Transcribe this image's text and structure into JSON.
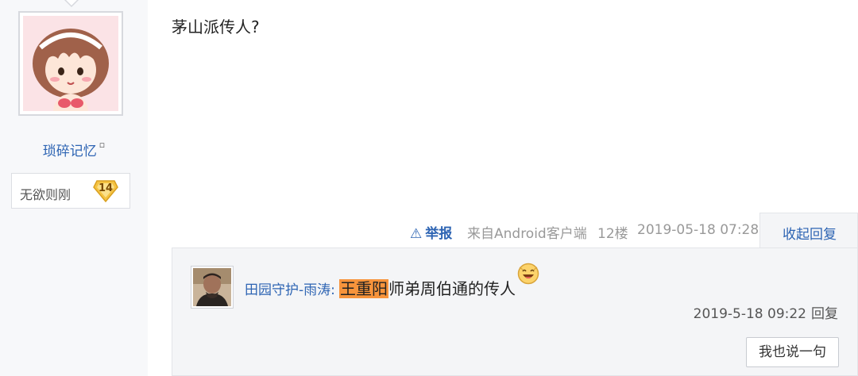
{
  "author": {
    "name": "琐碎记忆",
    "name_suffix": "▫",
    "level_name": "无欲则刚",
    "level_number": "14"
  },
  "post": {
    "content": "茅山派传人?"
  },
  "tail": {
    "report_icon": "⚠",
    "report_label": "举报",
    "source": "来自Android客户端",
    "floor": "12楼",
    "time": "2019-05-18 07:28",
    "collapse_label": "收起回复"
  },
  "reply": {
    "user": "田园守护-雨涛:",
    "highlight": "王重阳",
    "text": "师弟周伯通的传人",
    "time": "2019-5-18 09:22",
    "reply_label": "回复",
    "say_button": "我也说一句",
    "emoji_icon": "laughing-face-icon"
  },
  "colors": {
    "link": "#2d64b3",
    "highlight": "#f7943c",
    "panel_bg": "#f4f5f7",
    "sidebar_bg": "#f7f8fa"
  }
}
